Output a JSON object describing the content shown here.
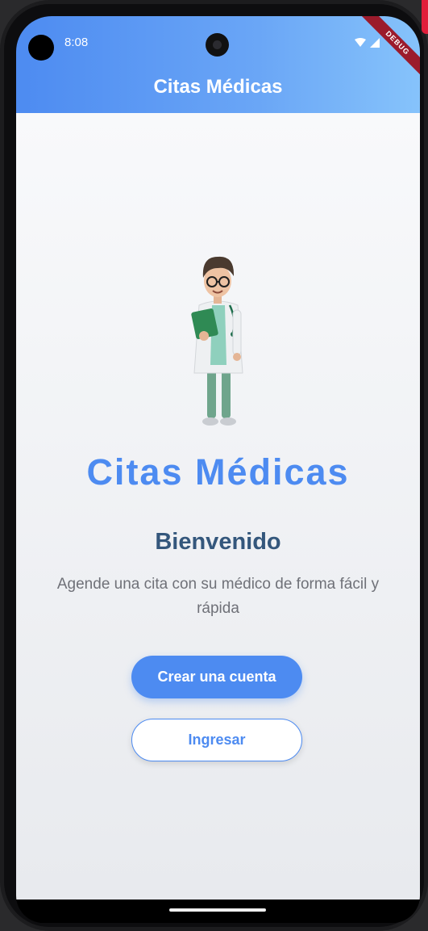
{
  "status_bar": {
    "time": "8:08"
  },
  "debug_banner": "DEBUG",
  "app_bar": {
    "title": "Citas Médicas"
  },
  "hero": {
    "image_alt": "doctor-illustration",
    "brand_title": "Citas Médicas",
    "welcome": "Bienvenido",
    "subtitle": "Agende una cita con su médico de forma fácil y rápida"
  },
  "actions": {
    "create_account": "Crear una cuenta",
    "login": "Ingresar"
  },
  "icons": {
    "wifi": "wifi-icon",
    "signal": "signal-icon"
  },
  "colors": {
    "primary": "#4d8bf1",
    "app_bar_end": "#86c3fb",
    "welcome_text": "#34577c",
    "subtitle_text": "#6f7178",
    "debug_banner": "#9b1b2c"
  }
}
